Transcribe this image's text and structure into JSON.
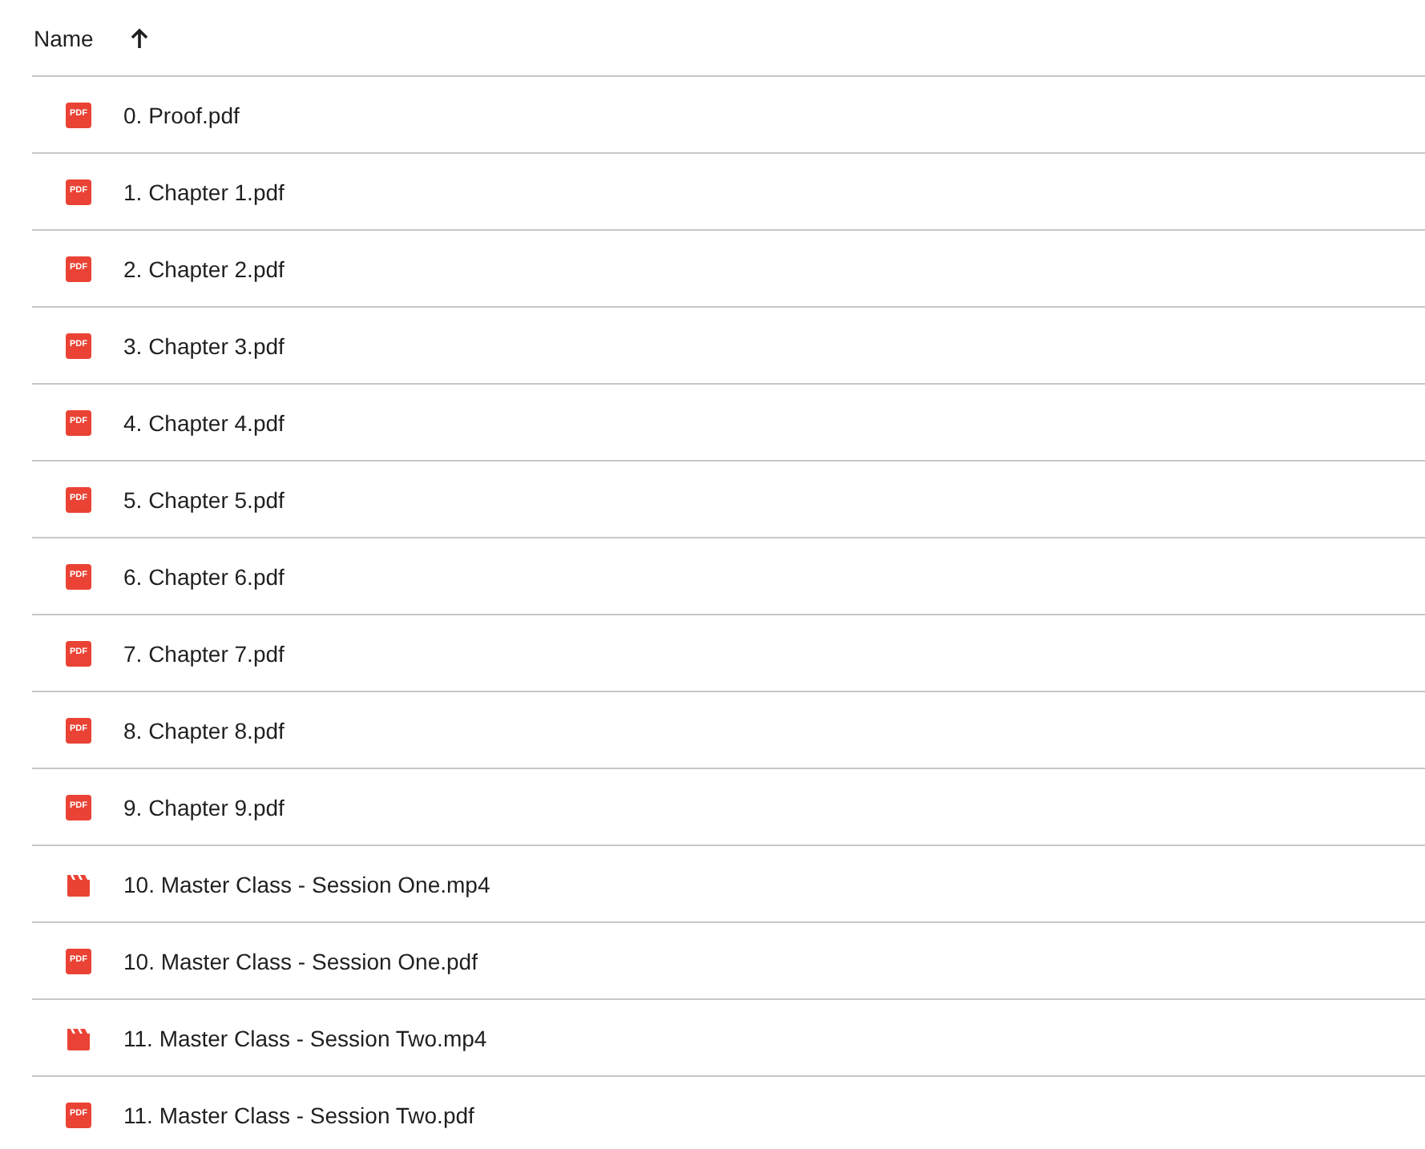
{
  "table": {
    "columns": [
      {
        "label": "Name",
        "sort_ascending": true
      }
    ],
    "rows": [
      {
        "kind": "pdf",
        "badge": "PDF",
        "name": "0. Proof.pdf"
      },
      {
        "kind": "pdf",
        "badge": "PDF",
        "name": "1. Chapter 1.pdf"
      },
      {
        "kind": "pdf",
        "badge": "PDF",
        "name": "2. Chapter 2.pdf"
      },
      {
        "kind": "pdf",
        "badge": "PDF",
        "name": "3. Chapter 3.pdf"
      },
      {
        "kind": "pdf",
        "badge": "PDF",
        "name": "4. Chapter 4.pdf"
      },
      {
        "kind": "pdf",
        "badge": "PDF",
        "name": "5. Chapter 5.pdf"
      },
      {
        "kind": "pdf",
        "badge": "PDF",
        "name": "6. Chapter 6.pdf"
      },
      {
        "kind": "pdf",
        "badge": "PDF",
        "name": "7. Chapter 7.pdf"
      },
      {
        "kind": "pdf",
        "badge": "PDF",
        "name": "8. Chapter 8.pdf"
      },
      {
        "kind": "pdf",
        "badge": "PDF",
        "name": "9. Chapter 9.pdf"
      },
      {
        "kind": "video",
        "name": "10. Master Class - Session One.mp4"
      },
      {
        "kind": "pdf",
        "badge": "PDF",
        "name": "10. Master Class - Session One.pdf"
      },
      {
        "kind": "video",
        "name": "11. Master Class - Session Two.mp4"
      },
      {
        "kind": "pdf",
        "badge": "PDF",
        "name": "11. Master Class - Session Two.pdf"
      }
    ]
  }
}
